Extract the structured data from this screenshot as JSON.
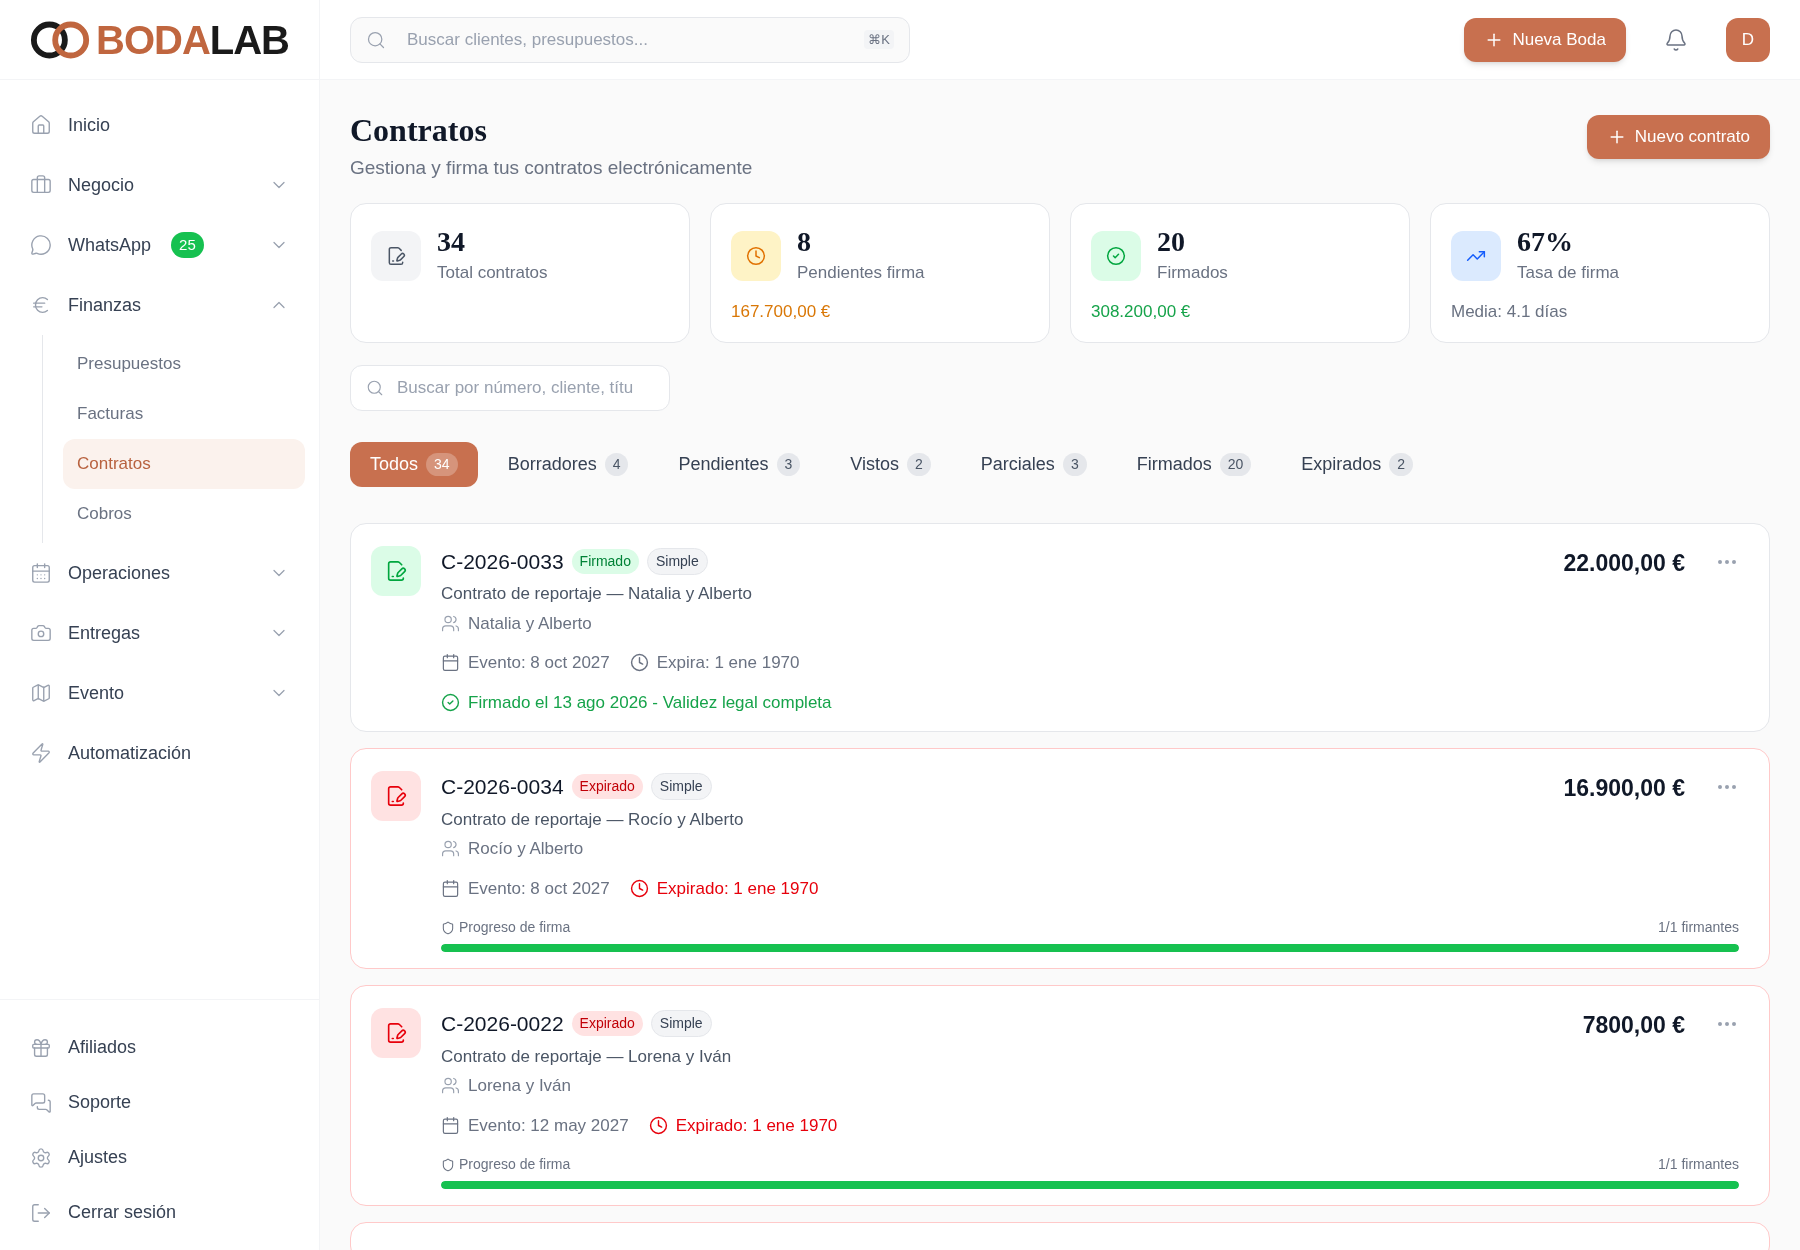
{
  "brand": {
    "first": "BODA",
    "second": "LAB"
  },
  "search": {
    "placeholder": "Buscar clientes, presupuestos...",
    "shortcut": "⌘K"
  },
  "header": {
    "new_button": "Nueva Boda",
    "avatar": "D"
  },
  "sidebar": {
    "items": [
      {
        "label": "Inicio",
        "selected": false
      },
      {
        "label": "Negocio",
        "selected": false,
        "expanded": false
      },
      {
        "label": "WhatsApp",
        "selected": false,
        "expanded": false,
        "badge": "25"
      },
      {
        "label": "Finanzas",
        "selected": false,
        "expanded": true,
        "children": [
          {
            "label": "Presupuestos",
            "selected": false
          },
          {
            "label": "Facturas",
            "selected": false
          },
          {
            "label": "Contratos",
            "selected": true
          },
          {
            "label": "Cobros",
            "selected": false
          }
        ]
      },
      {
        "label": "Operaciones",
        "selected": false,
        "expanded": false
      },
      {
        "label": "Entregas",
        "selected": false,
        "expanded": false
      },
      {
        "label": "Evento",
        "selected": false,
        "expanded": false
      },
      {
        "label": "Automatización",
        "selected": false
      }
    ],
    "footer_items": [
      {
        "label": "Afiliados"
      },
      {
        "label": "Soporte"
      },
      {
        "label": "Ajustes"
      },
      {
        "label": "Cerrar sesión"
      }
    ]
  },
  "page": {
    "title": "Contratos",
    "subtitle": "Gestiona y firma tus contratos electrónicamente",
    "action": "Nuevo contrato"
  },
  "stats": [
    {
      "kind": "total",
      "value": "34",
      "label": "Total contratos"
    },
    {
      "kind": "pending",
      "value": "8",
      "label": "Pendientes firma",
      "extra": "167.700,00 €"
    },
    {
      "kind": "signed",
      "value": "20",
      "label": "Firmados",
      "extra": "308.200,00 €"
    },
    {
      "kind": "rate",
      "value": "67%",
      "label": "Tasa de firma",
      "extra": "Media: 4.1 días"
    }
  ],
  "filter": {
    "placeholder": "Buscar por número, cliente, títu"
  },
  "tabs": [
    {
      "label": "Todos",
      "count": "34",
      "selected": true
    },
    {
      "label": "Borradores",
      "count": "4",
      "selected": false
    },
    {
      "label": "Pendientes",
      "count": "3",
      "selected": false
    },
    {
      "label": "Vistos",
      "count": "2",
      "selected": false
    },
    {
      "label": "Parciales",
      "count": "3",
      "selected": false
    },
    {
      "label": "Firmados",
      "count": "20",
      "selected": false
    },
    {
      "label": "Expirados",
      "count": "2",
      "selected": false
    }
  ],
  "contracts": [
    {
      "kind": "signed",
      "number": "C-2026-0033",
      "status": "Firmado",
      "type": "Simple",
      "title": "Contrato de reportaje — Natalia y Alberto",
      "client": "Natalia y Alberto",
      "event": "Evento: 8 oct 2027",
      "expiry": "Expira: 1 ene 1970",
      "amount": "22.000,00 €",
      "note": "Firmado el 13 ago 2026 - Validez legal completa"
    },
    {
      "kind": "expired",
      "number": "C-2026-0034",
      "status": "Expirado",
      "type": "Simple",
      "title": "Contrato de reportaje — Rocío y Alberto",
      "client": "Rocío y Alberto",
      "event": "Evento: 8 oct 2027",
      "expiry": "Expirado: 1 ene 1970",
      "amount": "16.900,00 €",
      "progress": {
        "label": "Progreso de firma",
        "reading": "1/1 firmantes",
        "level": 1
      }
    },
    {
      "kind": "expired",
      "number": "C-2026-0022",
      "status": "Expirado",
      "type": "Simple",
      "title": "Contrato de reportaje — Lorena y Iván",
      "client": "Lorena y Iván",
      "event": "Evento: 12 may 2027",
      "expiry": "Expirado: 1 ene 1970",
      "amount": "7800,00 €",
      "progress": {
        "label": "Progreso de firma",
        "reading": "1/1 firmantes",
        "level": 1
      }
    },
    {
      "kind": "expired"
    }
  ]
}
